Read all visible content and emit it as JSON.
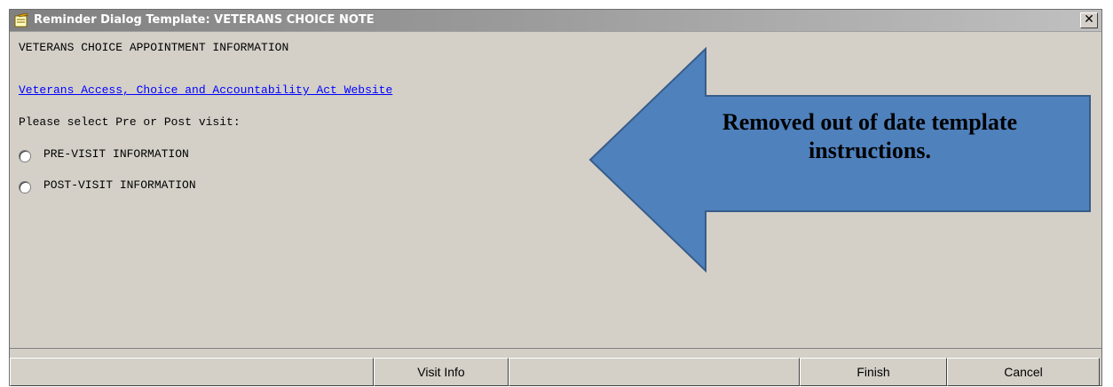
{
  "window": {
    "title": "Reminder Dialog Template: VETERANS CHOICE NOTE",
    "close_symbol": "✕"
  },
  "content": {
    "heading": "VETERANS CHOICE APPOINTMENT INFORMATION",
    "link_text": "Veterans Access, Choice and Accountability Act Website",
    "prompt": "Please select Pre or Post visit:",
    "options": [
      {
        "label": "PRE-VISIT INFORMATION",
        "selected": false
      },
      {
        "label": "POST-VISIT INFORMATION",
        "selected": false
      }
    ]
  },
  "footer": {
    "visit_info_label": "Visit Info",
    "finish_label": "Finish",
    "cancel_label": "Cancel"
  },
  "callout": {
    "text": "Removed out of date template instructions.",
    "fill_color": "#4f81bd",
    "stroke_color": "#385d8a"
  }
}
